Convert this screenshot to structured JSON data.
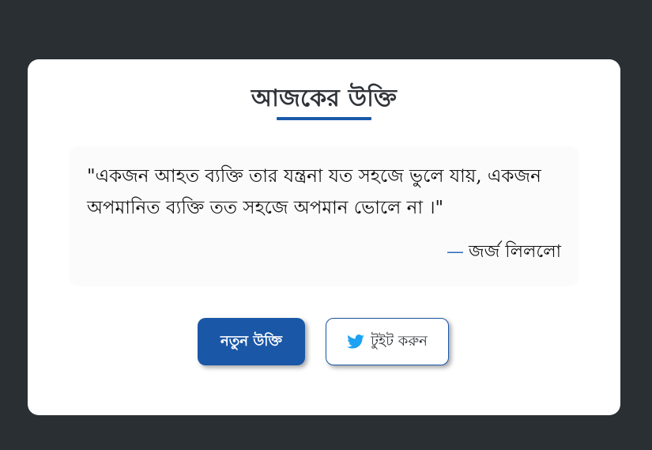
{
  "card": {
    "title": "আজকের উক্তি"
  },
  "quote": {
    "text": "\"একজন আহত ব্যক্তি তার যন্ত্রনা যত সহজে ভুলে যায়, একজন অপমানিত ব্যক্তি তত সহজে অপমান ভোলে না ।\"",
    "dash": "—",
    "author": "জর্জ লিললো"
  },
  "buttons": {
    "new_quote_label": "নতুন উক্তি",
    "tweet_label": "টুইট করুন",
    "tweet_icon": "twitter-bird-icon"
  },
  "colors": {
    "background": "#2a2f33",
    "card": "#ffffff",
    "accent": "#1a57a7",
    "twitter": "#1da1f2"
  }
}
